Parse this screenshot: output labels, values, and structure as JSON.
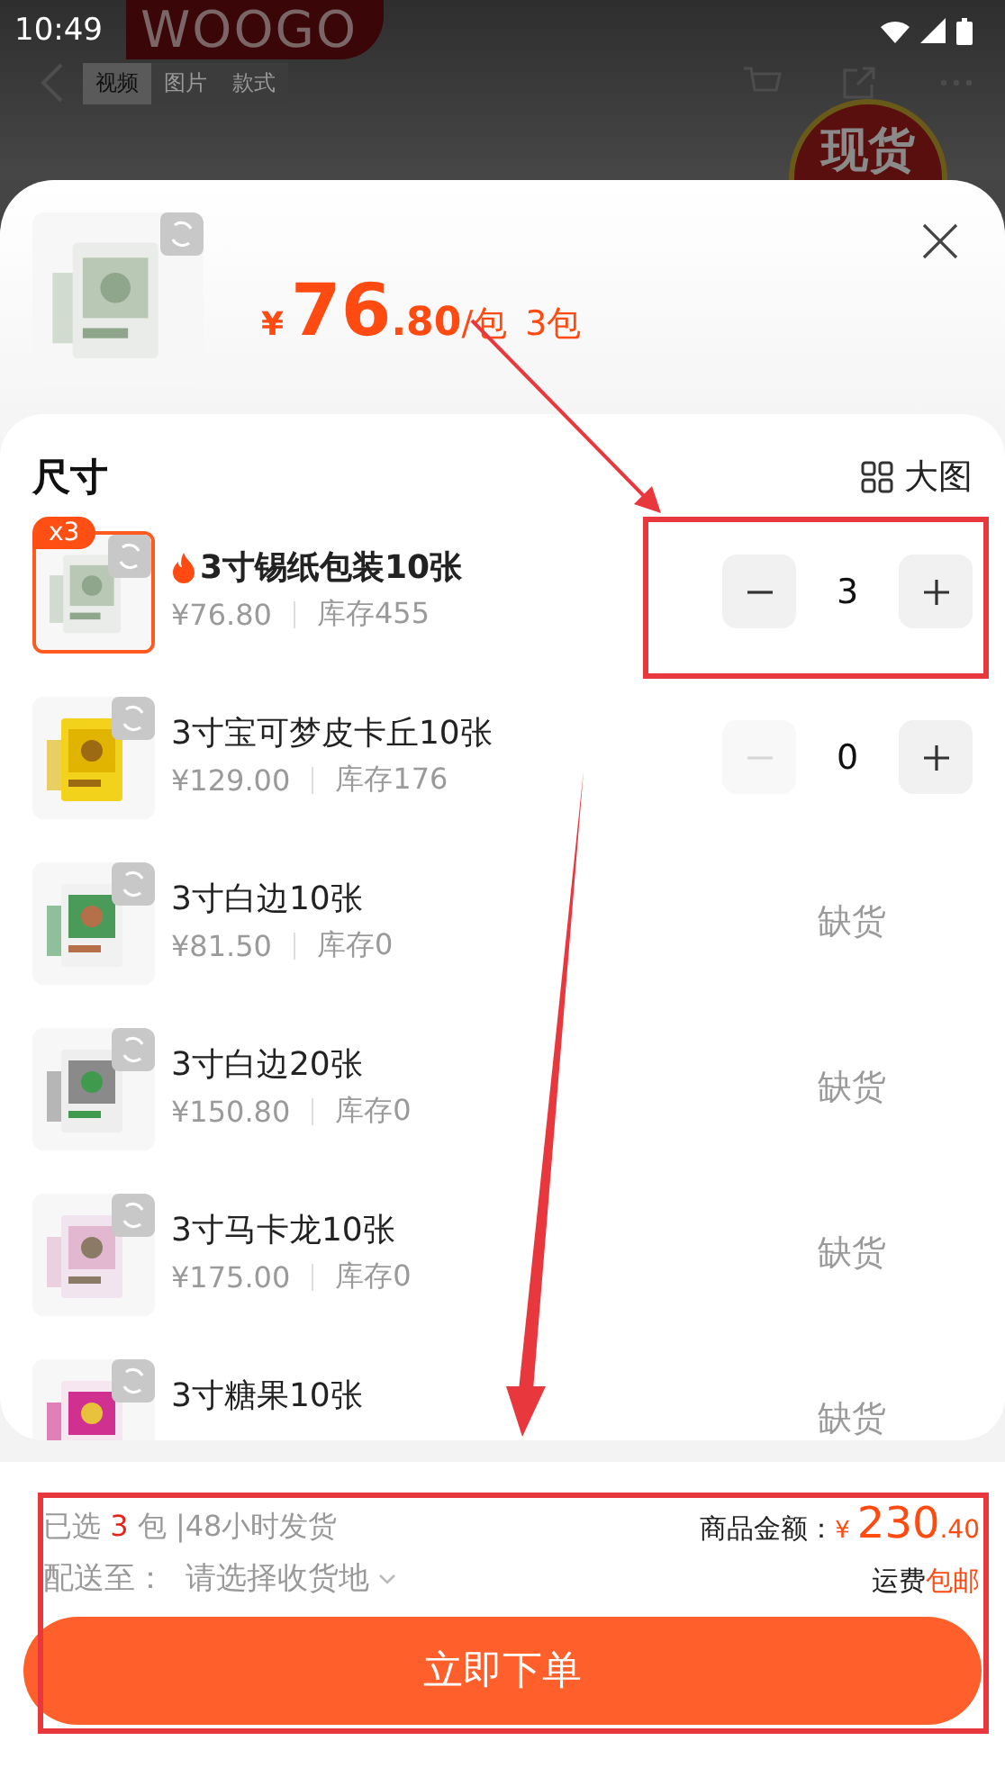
{
  "status_bar": {
    "time": "10:49"
  },
  "background_page": {
    "logo": "WOOGO",
    "tabs": [
      {
        "label": "视频",
        "selected": true
      },
      {
        "label": "图片",
        "selected": false
      },
      {
        "label": "款式",
        "selected": false
      }
    ],
    "badge": "现货"
  },
  "header": {
    "currency": "¥",
    "price_int": "76",
    "price_dec": ".80",
    "unit": "/包",
    "count": "3包"
  },
  "list": {
    "title": "尺寸",
    "view_toggle": "大图",
    "items": [
      {
        "name": "3寸锡纸包装10张",
        "price": "¥76.80",
        "stock": "库存455",
        "hot": true,
        "selected": true,
        "badge": "x3",
        "kind": "stepper",
        "quantity": "3",
        "minus_disabled": false
      },
      {
        "name": "3寸宝可梦皮卡丘10张",
        "price": "¥129.00",
        "stock": "库存176",
        "hot": false,
        "selected": false,
        "kind": "stepper",
        "quantity": "0",
        "minus_disabled": true
      },
      {
        "name": "3寸白边10张",
        "price": "¥81.50",
        "stock": "库存0",
        "hot": false,
        "selected": false,
        "kind": "sold_out",
        "status": "缺货"
      },
      {
        "name": "3寸白边20张",
        "price": "¥150.80",
        "stock": "库存0",
        "hot": false,
        "selected": false,
        "kind": "sold_out",
        "status": "缺货"
      },
      {
        "name": "3寸马卡龙10张",
        "price": "¥175.00",
        "stock": "库存0",
        "hot": false,
        "selected": false,
        "kind": "sold_out",
        "status": "缺货"
      },
      {
        "name": "3寸糖果10张",
        "hot": false,
        "selected": false,
        "kind": "sold_out",
        "status": "缺货"
      }
    ]
  },
  "footer": {
    "selected_prefix": "已选",
    "selected_count": "3",
    "selected_suffix": "包 |48小时发货",
    "total_label": "商品金额：",
    "total_currency": "¥",
    "total_int": "230",
    "total_dec": ".40",
    "deliver_label": "配送至：",
    "deliver_value": "请选择收货地",
    "shipping_label": "运费",
    "shipping_value": "包邮",
    "order_button": "立即下单"
  }
}
